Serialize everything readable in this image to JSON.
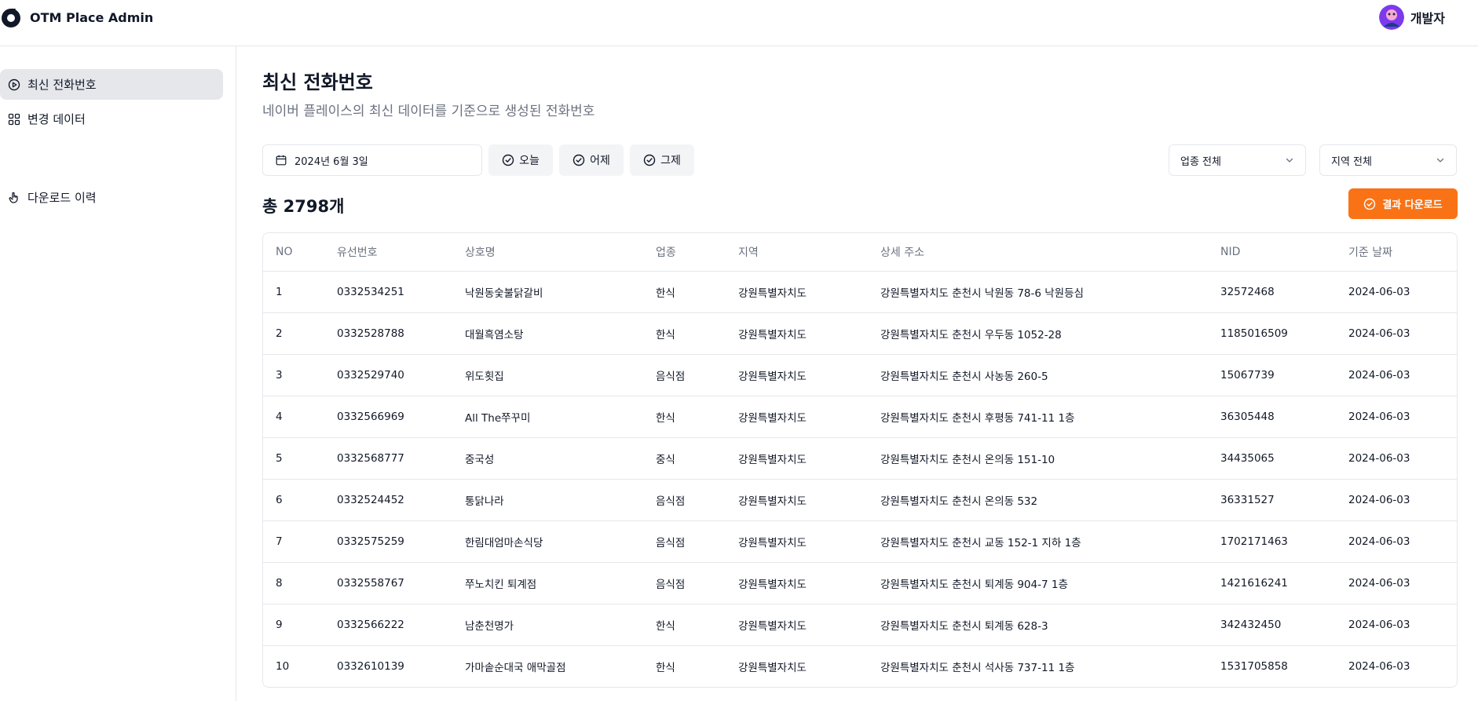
{
  "app": {
    "name": "OTM Place Admin"
  },
  "user": {
    "name": "개발자"
  },
  "sidebar": {
    "items": [
      {
        "label": "최신 전화번호",
        "icon": "play-circle-icon",
        "active": true
      },
      {
        "label": "변경 데이터",
        "icon": "grid-icon",
        "active": false
      },
      {
        "label": "다운로드 이력",
        "icon": "hand-pointer-icon",
        "active": false
      }
    ]
  },
  "page": {
    "title": "최신 전화번호",
    "subtitle": "네이버 플레이스의 최신 데이터를 기준으로 생성된 전화번호"
  },
  "filters": {
    "date": "2024년 6월 3일",
    "quick": [
      "오늘",
      "어제",
      "그제"
    ],
    "category_select": "업종 전체",
    "region_select": "지역 전체"
  },
  "summary": {
    "total": "총 2798개"
  },
  "actions": {
    "download_label": "결과 다운로드"
  },
  "colors": {
    "accent": "#f97316",
    "active_nav_bg": "#e5e7eb",
    "border": "#e5e7eb",
    "muted_text": "#6b7280"
  },
  "table": {
    "columns": [
      "NO",
      "유선번호",
      "상호명",
      "업종",
      "지역",
      "상세 주소",
      "NID",
      "기준 날짜"
    ],
    "rows": [
      [
        "1",
        "0332534251",
        "낙원동숯불닭갈비",
        "한식",
        "강원특별자치도",
        "강원특별자치도 춘천시 낙원동 78-6 낙원등심",
        "32572468",
        "2024-06-03"
      ],
      [
        "2",
        "0332528788",
        "대월흑염소탕",
        "한식",
        "강원특별자치도",
        "강원특별자치도 춘천시 우두동 1052-28",
        "1185016509",
        "2024-06-03"
      ],
      [
        "3",
        "0332529740",
        "위도횟집",
        "음식점",
        "강원특별자치도",
        "강원특별자치도 춘천시 사농동 260-5",
        "15067739",
        "2024-06-03"
      ],
      [
        "4",
        "0332566969",
        "All The쭈꾸미",
        "한식",
        "강원특별자치도",
        "강원특별자치도 춘천시 후평동 741-11 1층",
        "36305448",
        "2024-06-03"
      ],
      [
        "5",
        "0332568777",
        "중국성",
        "중식",
        "강원특별자치도",
        "강원특별자치도 춘천시 온의동 151-10",
        "34435065",
        "2024-06-03"
      ],
      [
        "6",
        "0332524452",
        "통닭나라",
        "음식점",
        "강원특별자치도",
        "강원특별자치도 춘천시 온의동 532",
        "36331527",
        "2024-06-03"
      ],
      [
        "7",
        "0332575259",
        "한림대엄마손식당",
        "음식점",
        "강원특별자치도",
        "강원특별자치도 춘천시 교동 152-1 지하 1층",
        "1702171463",
        "2024-06-03"
      ],
      [
        "8",
        "0332558767",
        "쭈노치킨 퇴계점",
        "음식점",
        "강원특별자치도",
        "강원특별자치도 춘천시 퇴계동 904-7 1층",
        "1421616241",
        "2024-06-03"
      ],
      [
        "9",
        "0332566222",
        "남춘천명가",
        "한식",
        "강원특별자치도",
        "강원특별자치도 춘천시 퇴계동 628-3",
        "342432450",
        "2024-06-03"
      ],
      [
        "10",
        "0332610139",
        "가마솥순대국 애막골점",
        "한식",
        "강원특별자치도",
        "강원특별자치도 춘천시 석사동 737-11 1층",
        "1531705858",
        "2024-06-03"
      ]
    ]
  }
}
